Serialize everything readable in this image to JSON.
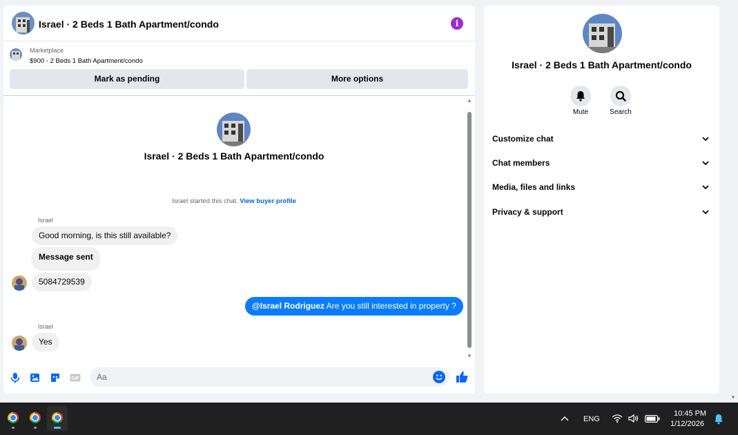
{
  "chat": {
    "title": "Israel · 2 Beds 1 Bath Apartment/condo",
    "listing_label": "Marketplace",
    "listing_price": "$900 - 2 Beds 1 Bath Apartment/condo",
    "mark_pending": "Mark as pending",
    "more_options": "More options",
    "intro_title": "Israel · 2 Beds 1 Bath Apartment/condo",
    "started_text": "Israel started this chat. ",
    "view_profile": "View buyer profile",
    "messages": [
      {
        "sender": "Israel",
        "text": "Good morning, is this still available?"
      },
      {
        "text": "Message sent"
      },
      {
        "text": "5084729539"
      },
      {
        "mention": "@Israel Rodriguez",
        "text": " Are you still interested in property ?"
      },
      {
        "sender": "Israel",
        "text": "Yes"
      }
    ],
    "composer_placeholder": "Aa"
  },
  "info": {
    "title": "Israel · 2 Beds 1 Bath Apartment/condo",
    "mute_label": "Mute",
    "search_label": "Search",
    "sections": [
      "Customize chat",
      "Chat members",
      "Media, files and links",
      "Privacy & support"
    ]
  },
  "taskbar": {
    "language": "ENG",
    "time": "10:45 PM",
    "date": "1/12/2026"
  },
  "colors": {
    "accent": "#0866ff",
    "outgoing_bubble": "#0a7cff",
    "info_icon": "#9c2bd4",
    "taskbar": "#202020"
  }
}
